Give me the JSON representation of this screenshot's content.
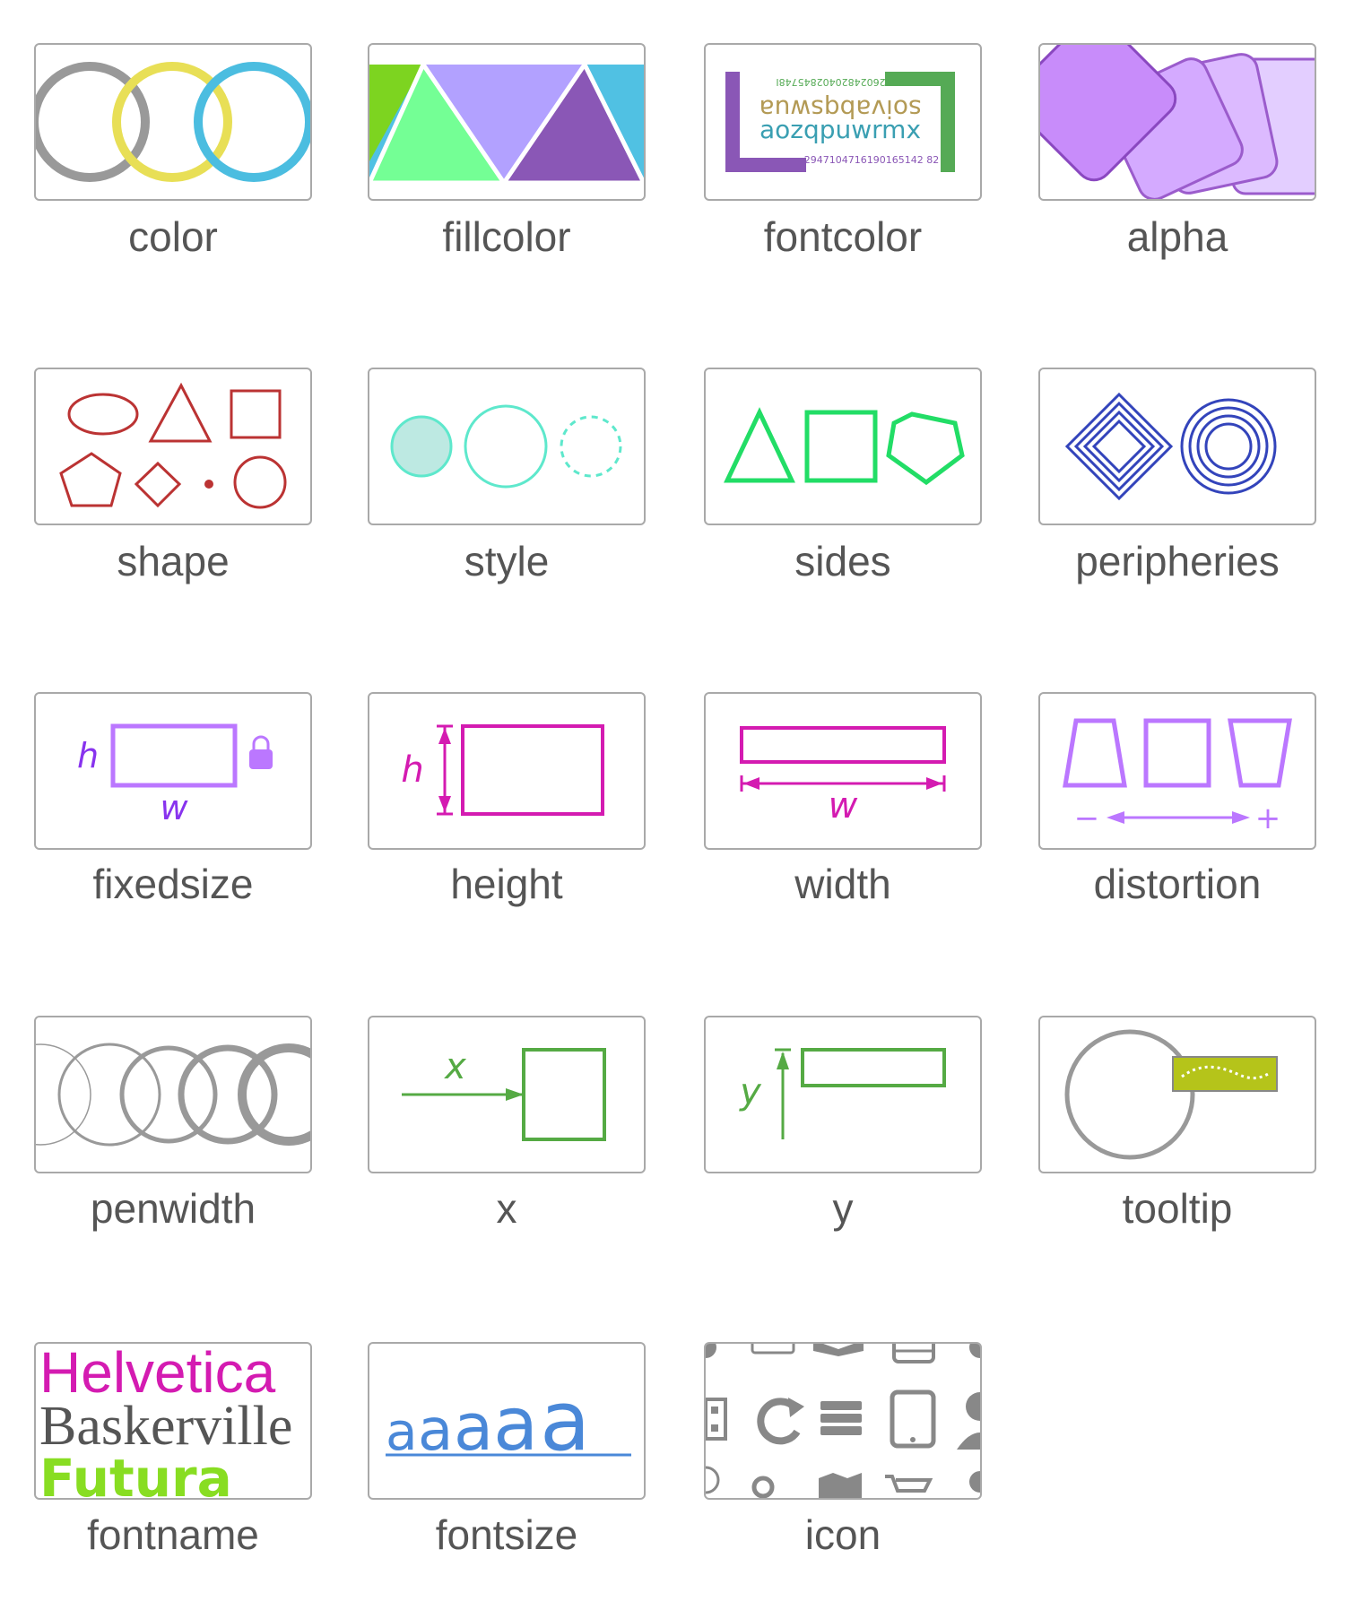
{
  "tiles": [
    {
      "label": "color"
    },
    {
      "label": "fillcolor"
    },
    {
      "label": "fontcolor",
      "mirrored_digits": "20426024820402845748I",
      "mirrored_word": "soivabqswua",
      "word": "aozqpuwrmx",
      "digits": "2947104716190165142 82"
    },
    {
      "label": "alpha"
    },
    {
      "label": "shape"
    },
    {
      "label": "style"
    },
    {
      "label": "sides"
    },
    {
      "label": "peripheries"
    },
    {
      "label": "fixedsize",
      "h": "h",
      "w": "w"
    },
    {
      "label": "height",
      "h": "h"
    },
    {
      "label": "width",
      "w": "w"
    },
    {
      "label": "distortion",
      "minus": "−",
      "plus": "+"
    },
    {
      "label": "penwidth"
    },
    {
      "label": "x",
      "x": "x"
    },
    {
      "label": "y",
      "y": "y"
    },
    {
      "label": "tooltip"
    },
    {
      "label": "fontname",
      "fonts": [
        "Helvetica",
        "Baskerville",
        "Futura"
      ]
    },
    {
      "label": "fontsize",
      "sample": "aaaaa"
    },
    {
      "label": "icon"
    }
  ],
  "colors": {
    "border": "#a9a9a9",
    "label_text": "#555555",
    "gray": "#999999",
    "yellow": "#e8df56",
    "cyan": "#4bbde0",
    "green_fill": "#7dd420",
    "mint": "#74ff95",
    "lavender": "#b2a1ff",
    "purple": "#8a57b6",
    "sky": "#50c1e3",
    "red_shape": "#bb3333",
    "teal": "#5ee8cc",
    "sides_green": "#22dd66",
    "periph_blue": "#3344bb",
    "violet": "#bb77ff",
    "magenta": "#d41bb1",
    "xy_green": "#55aa44",
    "tooltip_fill": "#b5c41a",
    "fontsize_blue": "#4a88d8",
    "font_magenta": "#d41bb1",
    "font_gray": "#555555",
    "font_green": "#88dd22"
  }
}
